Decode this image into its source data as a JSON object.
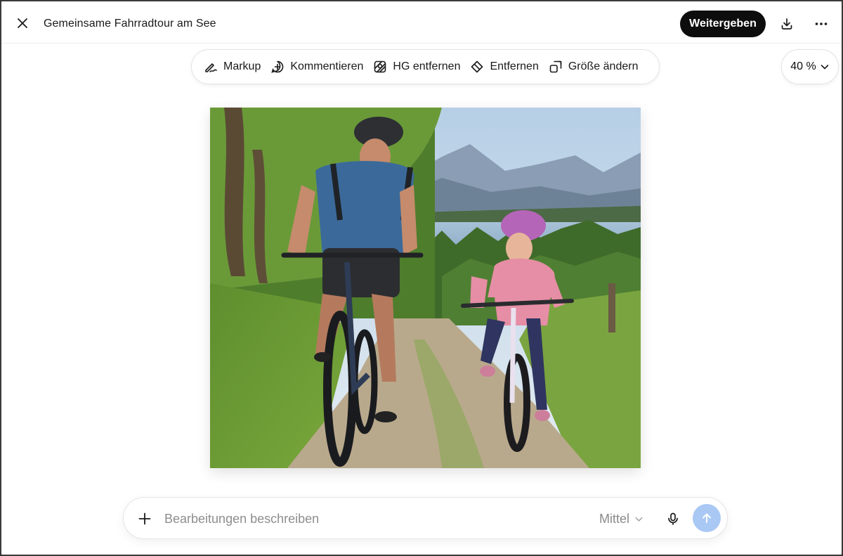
{
  "header": {
    "title": "Gemeinsame Fahrradtour am See",
    "share_label": "Weitergeben",
    "icons": {
      "close": "close-icon",
      "download": "download-icon",
      "more": "more-horizontal-icon"
    }
  },
  "toolbar": {
    "tools": [
      {
        "label": "Markup",
        "icon": "markup-pen-icon"
      },
      {
        "label": "Kommentieren",
        "icon": "add-comment-icon"
      },
      {
        "label": "HG entfernen",
        "icon": "remove-background-icon"
      },
      {
        "label": "Entfernen",
        "icon": "eraser-icon"
      },
      {
        "label": "Größe ändern",
        "icon": "resize-icon"
      }
    ],
    "zoom": "40 %"
  },
  "composer": {
    "placeholder": "Bearbeitungen beschreiben",
    "quality": "Mittel",
    "send_color": "#a9c8f4"
  },
  "colors": {
    "primary_button": "#0d0d0d",
    "send_disabled": "#a9c8f4"
  }
}
